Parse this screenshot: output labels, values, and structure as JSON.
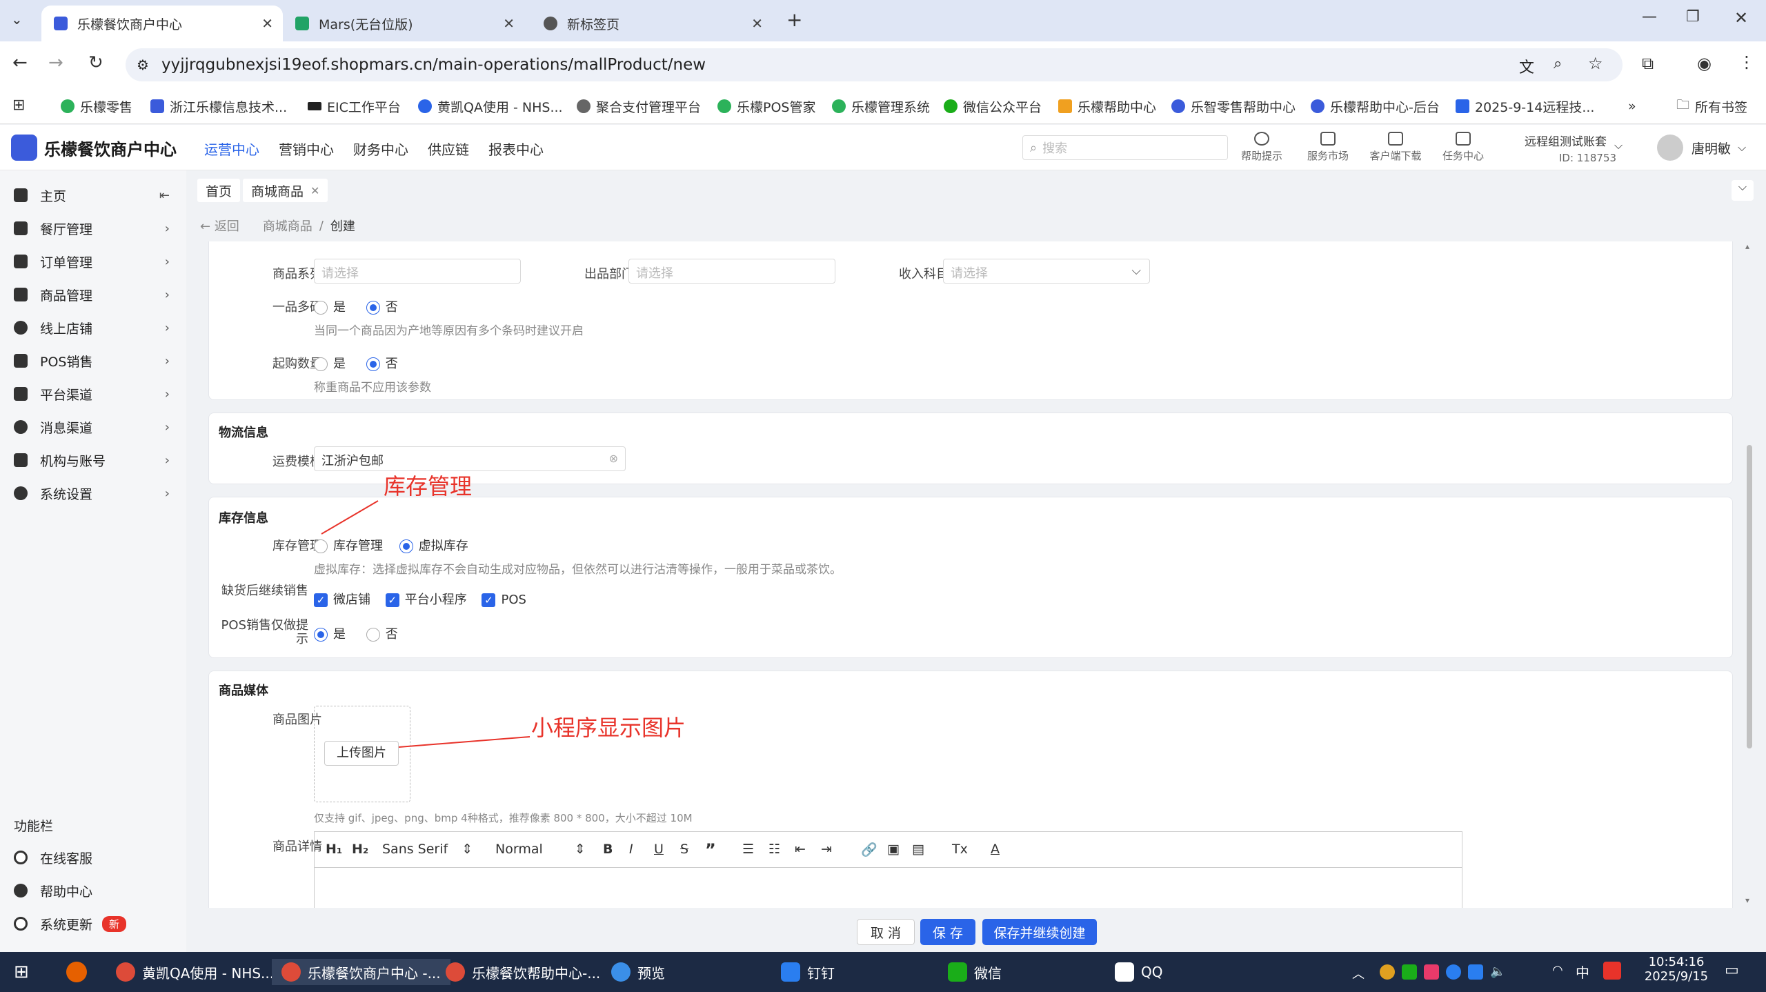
{
  "browser": {
    "tabs": [
      {
        "title": "乐檬餐饮商户中心",
        "active": true
      },
      {
        "title": "Mars(无台位版)",
        "active": false
      },
      {
        "title": "新标签页",
        "active": false
      }
    ],
    "url": "yyjjrqgubnexjsi19eof.shopmars.cn/main-operations/mallProduct/new",
    "bookmarks": [
      "乐檬零售",
      "浙江乐檬信息技术...",
      "EIC工作平台",
      "黄凯QA使用 - NHS...",
      "聚合支付管理平台",
      "乐檬POS管家",
      "乐檬管理系统",
      "微信公众平台",
      "乐檬帮助中心",
      "乐智零售帮助中心",
      "乐檬帮助中心-后台",
      "2025-9-14远程技..."
    ],
    "bookmarks_more": "»",
    "all_bookmarks": "所有书签"
  },
  "app": {
    "logo": "乐檬餐饮商户中心",
    "nav": [
      "运营中心",
      "营销中心",
      "财务中心",
      "供应链",
      "报表中心"
    ],
    "search_placeholder": "搜索",
    "header_icons": [
      "帮助提示",
      "服务市场",
      "客户端下载",
      "任务中心"
    ],
    "account_name": "远程组测试账套",
    "account_id": "ID: 118753",
    "user": "唐明敏"
  },
  "sidebar": {
    "items": [
      "主页",
      "餐厅管理",
      "订单管理",
      "商品管理",
      "线上店铺",
      "POS销售",
      "平台渠道",
      "消息渠道",
      "机构与账号",
      "系统设置"
    ],
    "func_title": "功能栏",
    "func_items": [
      "在线客服",
      "帮助中心",
      "系统更新"
    ],
    "new_badge": "新"
  },
  "page": {
    "tabs": [
      "首页",
      "商城商品"
    ],
    "back": "返回",
    "breadcrumb": [
      "商城商品",
      "创建"
    ],
    "series_label": "商品系列",
    "series_placeholder": "请选择",
    "dept_label": "出品部门",
    "dept_placeholder": "请选择",
    "income_label": "收入科目",
    "income_placeholder": "请选择",
    "multicode_label": "一品多码",
    "yes": "是",
    "no": "否",
    "multicode_hint": "当同一个商品因为产地等原因有多个条码时建议开启",
    "minqty_label": "起购数量",
    "minqty_hint": "称重商品不应用该参数",
    "logistics_title": "物流信息",
    "freight_label": "运费模板",
    "freight_value": "江浙沪包邮",
    "inventory_title": "库存信息",
    "inv_label": "库存管理",
    "inv_option_real": "库存管理",
    "inv_option_virtual": "虚拟库存",
    "inv_hint": "虚拟库存：选择虚拟库存不会自动生成对应物品，但依然可以进行沽清等操作，一般用于菜品或茶饮。",
    "oos_label": "缺货后继续销售",
    "oos_options": [
      "微店铺",
      "平台小程序",
      "POS"
    ],
    "pos_hint_label": "POS销售仅做提示",
    "media_title": "商品媒体",
    "image_label": "商品图片",
    "upload_btn": "上传图片",
    "image_hint": "仅支持 gif、jpeg、png、bmp 4种格式，推荐像素 800 * 800，大小不超过 10M",
    "detail_label": "商品详情",
    "editor_font": "Sans Serif",
    "editor_size": "Normal",
    "annotation_inventory": "库存管理",
    "annotation_image": "小程序显示图片",
    "cancel": "取 消",
    "save": "保 存",
    "save_continue": "保存并继续创建"
  },
  "taskbar": {
    "items": [
      "黄凯QA使用 - NHS...",
      "乐檬餐饮商户中心 -...",
      "乐檬餐饮帮助中心-...",
      "预览",
      "钉钉",
      "微信",
      "QQ"
    ],
    "ime": "中",
    "time": "10:54:16",
    "date": "2025/9/15"
  }
}
